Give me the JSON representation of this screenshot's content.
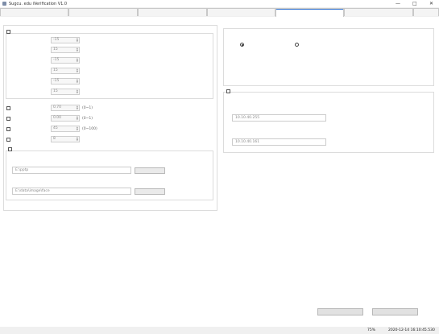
{
  "window": {
    "title": "Sugcu. edu iVerification",
    "version": "V1.0",
    "minimize": "—",
    "maximize": "□",
    "close": "✕"
  },
  "tabs": [
    "",
    "",
    "",
    "",
    "",
    "",
    ""
  ],
  "face_params": {
    "title": "",
    "face_detect": {
      "label": "",
      "rows": [
        {
          "label": "",
          "value": "-15",
          "hint": ""
        },
        {
          "label": "",
          "value": "15",
          "hint": ""
        },
        {
          "label": "",
          "value": "-15",
          "hint": ""
        },
        {
          "label": "",
          "value": "15",
          "hint": ""
        },
        {
          "label": "",
          "value": "-15",
          "hint": ""
        },
        {
          "label": "",
          "value": "15",
          "hint": ""
        }
      ]
    },
    "checks": [
      {
        "label": "",
        "value": "0.70",
        "hint": "(0~1)"
      },
      {
        "label": "",
        "value": "0.00",
        "hint": "(0~1)"
      },
      {
        "label": "",
        "value": "45",
        "hint": "(0~100)"
      },
      {
        "label": "",
        "value": "8",
        "hint": ""
      }
    ],
    "save_path": {
      "label": "",
      "capture_label": "",
      "capture_value": "E:\\pptp",
      "capture_button": "",
      "face_label": "",
      "face_value": "E:\\data\\image\\face",
      "face_button": ""
    }
  },
  "voice": {
    "title": "",
    "switch_label": "",
    "on_label": "",
    "off_label": "",
    "selected": "on"
  },
  "network": {
    "title": "",
    "broadcast_label": "",
    "broadcast_value": "10.10.40.255",
    "server_label": "",
    "server_value": "10.10.40.161"
  },
  "footer": {
    "confirm": "",
    "cancel": ""
  },
  "status": {
    "memory": "75%",
    "datetime": "2020-12-14 16:10:45.530"
  },
  "colors": {
    "accent": "#3a78d4"
  }
}
